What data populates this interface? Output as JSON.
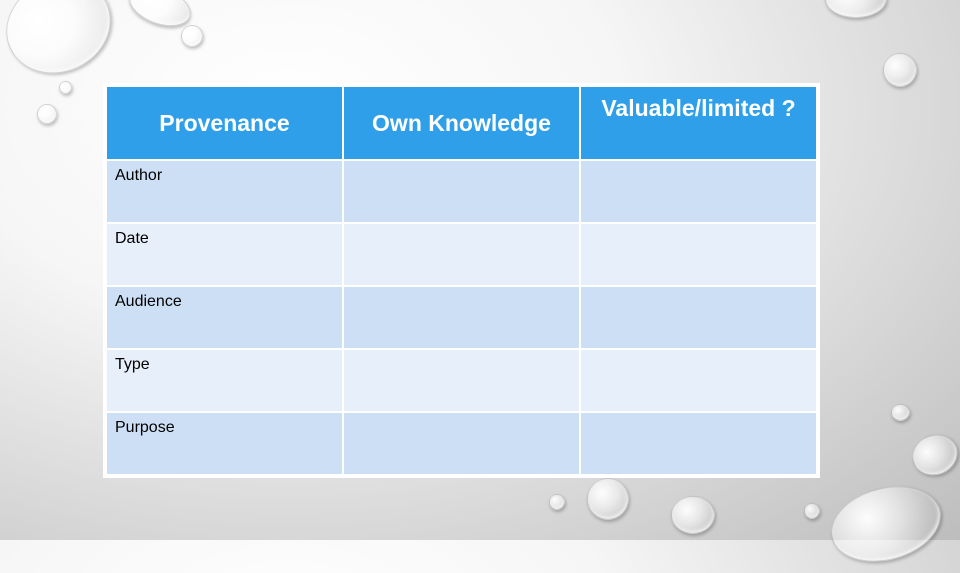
{
  "slide": {
    "table": {
      "headers": [
        "Provenance",
        "Own Knowledge",
        "Valuable/limited ?"
      ],
      "rows": [
        {
          "label": "Author",
          "own_knowledge": "",
          "valuable_limited": ""
        },
        {
          "label": "Date",
          "own_knowledge": "",
          "valuable_limited": ""
        },
        {
          "label": "Audience",
          "own_knowledge": "",
          "valuable_limited": ""
        },
        {
          "label": "Type",
          "own_knowledge": "",
          "valuable_limited": ""
        },
        {
          "label": "Purpose",
          "own_knowledge": "",
          "valuable_limited": ""
        }
      ]
    },
    "colors": {
      "header": "#2f9fe9",
      "row_odd": "#cddff5",
      "row_even": "#e7effa"
    },
    "background": "water-droplets"
  }
}
